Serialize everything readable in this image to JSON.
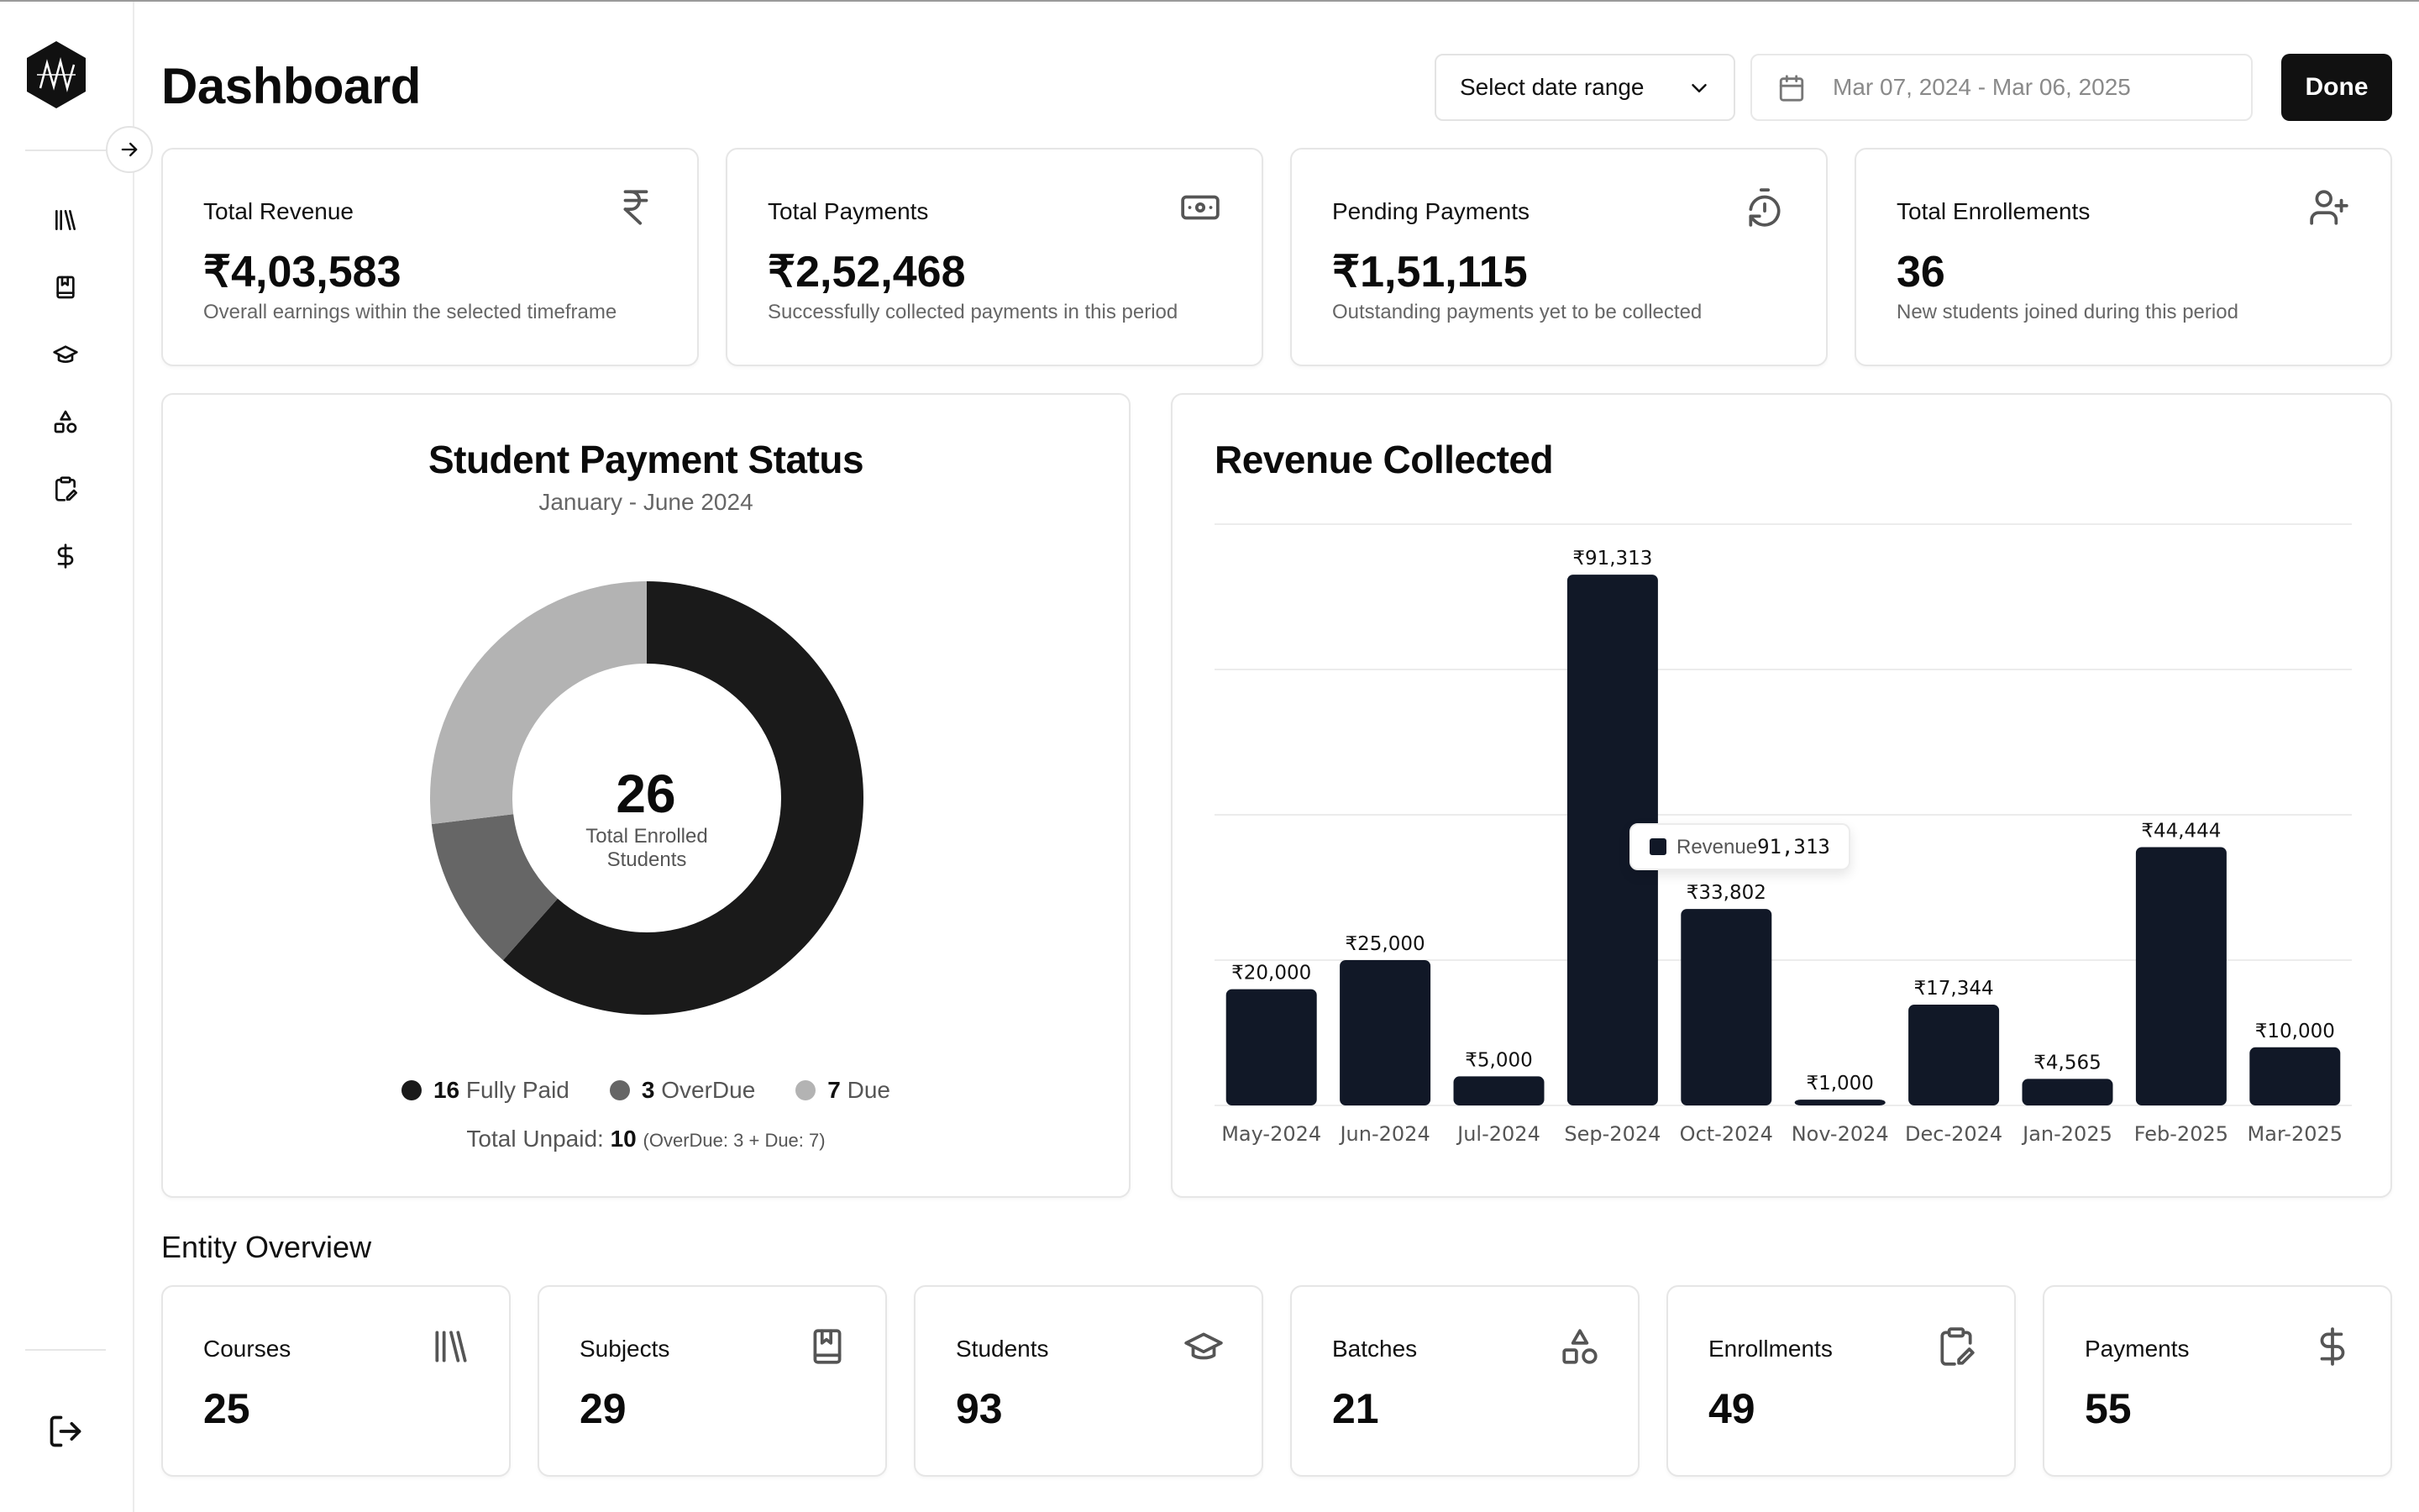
{
  "header": {
    "title": "Dashboard",
    "date_select_label": "Select date range",
    "date_range_value": "Mar 07, 2024 - Mar 06, 2025",
    "done_label": "Done"
  },
  "sidebar": {
    "items": [
      {
        "name": "courses",
        "icon": "library-icon"
      },
      {
        "name": "subjects",
        "icon": "book-bookmark-icon"
      },
      {
        "name": "students",
        "icon": "graduation-cap-icon"
      },
      {
        "name": "batches",
        "icon": "shapes-icon"
      },
      {
        "name": "enrollments",
        "icon": "clipboard-edit-icon"
      },
      {
        "name": "payments",
        "icon": "dollar-sign-icon"
      }
    ]
  },
  "stats": [
    {
      "label": "Total Revenue",
      "value": "₹4,03,583",
      "desc": "Overall earnings within the selected timeframe",
      "icon": "rupee-icon"
    },
    {
      "label": "Total Payments",
      "value": "₹2,52,468",
      "desc": "Successfully collected payments in this period",
      "icon": "banknote-icon"
    },
    {
      "label": "Pending Payments",
      "value": "₹1,51,115",
      "desc": "Outstanding payments yet to be collected",
      "icon": "timer-reset-icon"
    },
    {
      "label": "Total Enrollements",
      "value": "36",
      "desc": "New students joined during this period",
      "icon": "user-plus-icon"
    }
  ],
  "payment_status": {
    "title": "Student Payment Status",
    "subtitle": "January - June 2024",
    "center_value": "26",
    "center_label_1": "Total Enrolled",
    "center_label_2": "Students",
    "legend": [
      {
        "count": "16",
        "label": "Fully Paid",
        "color": "#1a1a1a"
      },
      {
        "count": "3",
        "label": "OverDue",
        "color": "#666666"
      },
      {
        "count": "7",
        "label": "Due",
        "color": "#b3b3b3"
      }
    ],
    "unpaid_prefix": "Total Unpaid:",
    "unpaid_value": "10",
    "unpaid_detail": "(OverDue: 3 + Due: 7)"
  },
  "revenue": {
    "title": "Revenue Collected",
    "tooltip_label": "Revenue",
    "tooltip_value": "91,313"
  },
  "entity_overview": {
    "title": "Entity Overview",
    "items": [
      {
        "label": "Courses",
        "value": "25",
        "icon": "library-icon"
      },
      {
        "label": "Subjects",
        "value": "29",
        "icon": "book-bookmark-icon"
      },
      {
        "label": "Students",
        "value": "93",
        "icon": "graduation-cap-icon"
      },
      {
        "label": "Batches",
        "value": "21",
        "icon": "shapes-icon"
      },
      {
        "label": "Enrollments",
        "value": "49",
        "icon": "clipboard-edit-icon"
      },
      {
        "label": "Payments",
        "value": "55",
        "icon": "dollar-sign-icon"
      }
    ]
  },
  "chart_data": [
    {
      "type": "pie",
      "title": "Student Payment Status",
      "subtitle": "January - June 2024",
      "categories": [
        "Fully Paid",
        "OverDue",
        "Due"
      ],
      "values": [
        16,
        3,
        7
      ],
      "colors": [
        "#1a1a1a",
        "#666666",
        "#b3b3b3"
      ],
      "donut": true,
      "center_value": 26
    },
    {
      "type": "bar",
      "title": "Revenue Collected",
      "categories": [
        "May-2024",
        "Jun-2024",
        "Jul-2024",
        "Sep-2024",
        "Oct-2024",
        "Nov-2024",
        "Dec-2024",
        "Jan-2025",
        "Feb-2025",
        "Mar-2025"
      ],
      "values": [
        20000,
        25000,
        5000,
        91313,
        33802,
        1000,
        17344,
        4565,
        44444,
        10000
      ],
      "value_labels": [
        "₹20,000",
        "₹25,000",
        "₹5,000",
        "₹91,313",
        "₹33,802",
        "₹1,000",
        "₹17,344",
        "₹4,565",
        "₹44,444",
        "₹10,000"
      ],
      "bar_color": "#111827",
      "ylim": [
        0,
        100000
      ],
      "grid": true,
      "xlabel": "",
      "ylabel": ""
    }
  ]
}
